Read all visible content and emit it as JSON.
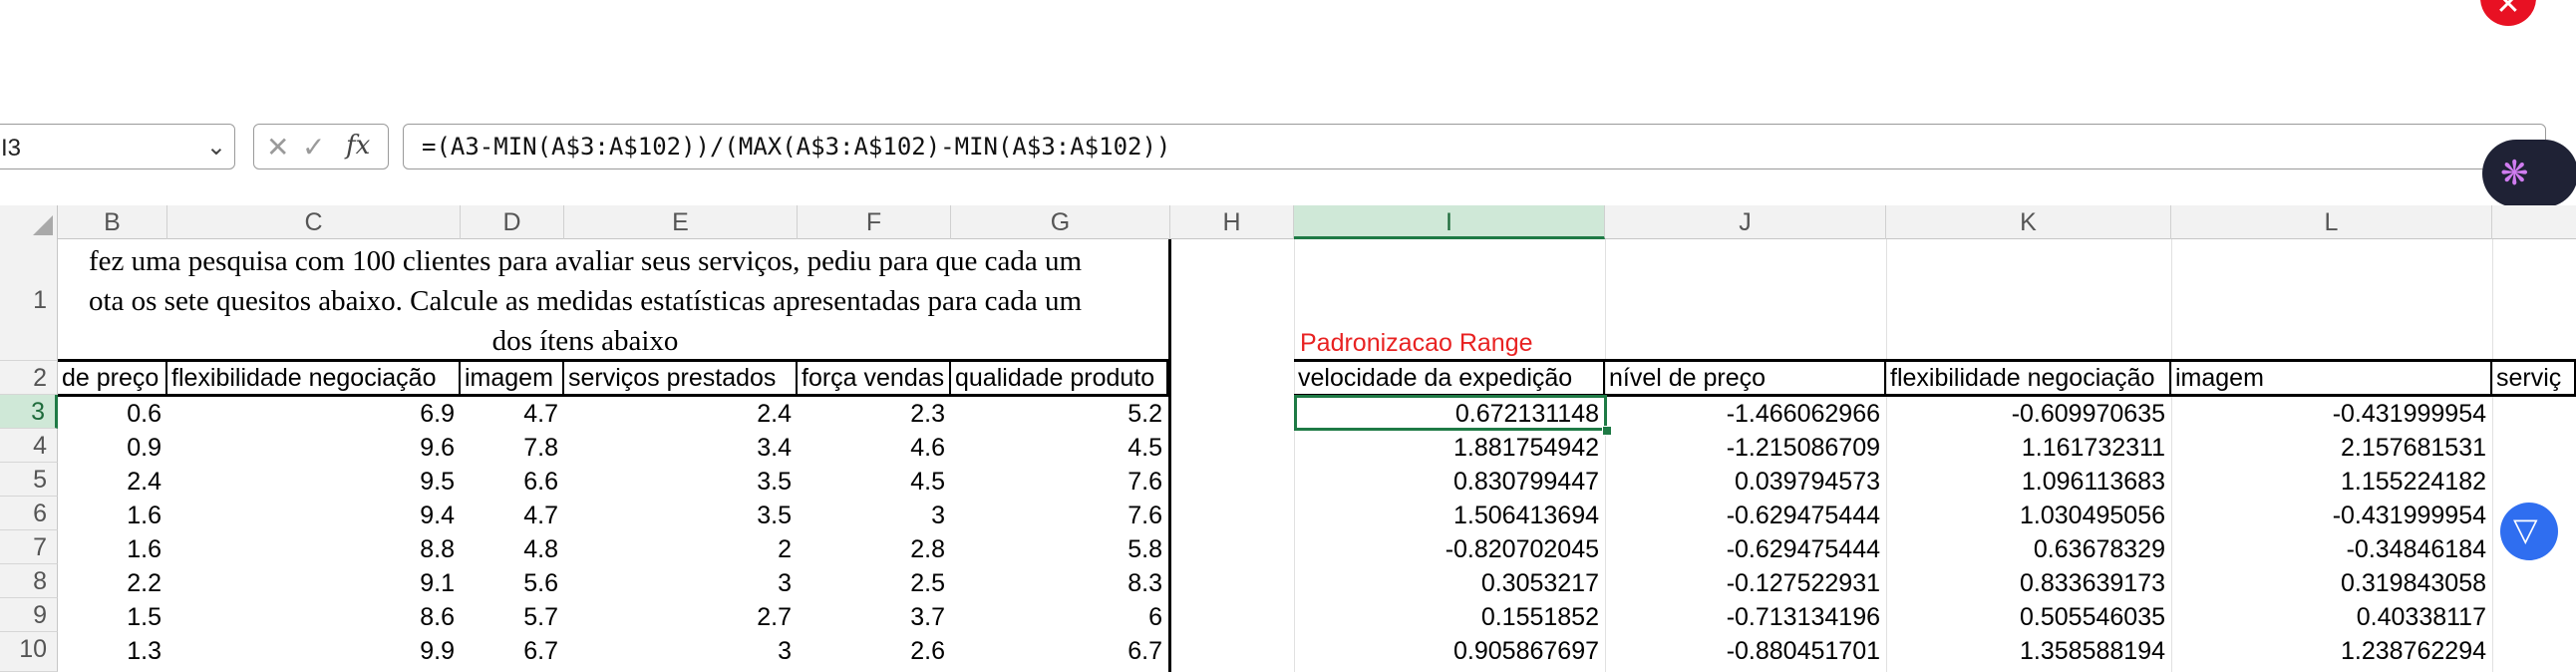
{
  "formula_bar": {
    "name_box": "I3",
    "formula": "=(A3-MIN(A$3:A$102))/(MAX(A$3:A$102)-MIN(A$3:A$102))"
  },
  "column_headers": [
    "B",
    "C",
    "D",
    "E",
    "F",
    "G",
    "H",
    "I",
    "J",
    "K",
    "L"
  ],
  "row_numbers": [
    "1",
    "2",
    "3",
    "4",
    "5",
    "6",
    "7",
    "8",
    "9",
    "10"
  ],
  "title_lines": [
    "fez uma pesquisa com 100 clientes para avaliar seus serviços, pediu para que cada um",
    "ota os sete quesitos abaixo. Calcule as medidas estatísticas apresentadas para cada um",
    "dos ítens abaixo"
  ],
  "red_label": "Padronizacao Range",
  "left_table": {
    "headers": [
      "de preço",
      "flexibilidade negociação",
      "imagem",
      "serviços prestados",
      "força vendas",
      "qualidade produto"
    ],
    "rows": [
      [
        "0.6",
        "6.9",
        "4.7",
        "2.4",
        "2.3",
        "5.2"
      ],
      [
        "0.9",
        "9.6",
        "7.8",
        "3.4",
        "4.6",
        "4.5"
      ],
      [
        "2.4",
        "9.5",
        "6.6",
        "3.5",
        "4.5",
        "7.6"
      ],
      [
        "1.6",
        "9.4",
        "4.7",
        "3.5",
        "3",
        "7.6"
      ],
      [
        "1.6",
        "8.8",
        "4.8",
        "2",
        "2.8",
        "5.8"
      ],
      [
        "2.2",
        "9.1",
        "5.6",
        "3",
        "2.5",
        "8.3"
      ],
      [
        "1.5",
        "8.6",
        "5.7",
        "2.7",
        "3.7",
        "6"
      ],
      [
        "1.3",
        "9.9",
        "6.7",
        "3",
        "2.6",
        "6.7"
      ]
    ]
  },
  "right_table": {
    "headers": [
      "velocidade da expedição",
      "nível de preço",
      "flexibilidade negociação",
      "imagem",
      "serviç"
    ],
    "rows": [
      [
        "0.672131148",
        "-1.466062966",
        "-0.609970635",
        "-0.431999954"
      ],
      [
        "1.881754942",
        "-1.215086709",
        "1.161732311",
        "2.157681531"
      ],
      [
        "0.830799447",
        "0.039794573",
        "1.096113683",
        "1.155224182"
      ],
      [
        "1.506413694",
        "-0.629475444",
        "1.030495056",
        "-0.431999954"
      ],
      [
        "-0.820702045",
        "-0.629475444",
        "0.63678329",
        "-0.34846184"
      ],
      [
        "0.3053217",
        "-0.127522931",
        "0.833639173",
        "0.319843058"
      ],
      [
        "0.1551852",
        "-0.713134196",
        "0.505546035",
        "0.40338117"
      ],
      [
        "0.905867697",
        "-0.880451701",
        "1.358588194",
        "1.238762294"
      ]
    ]
  }
}
